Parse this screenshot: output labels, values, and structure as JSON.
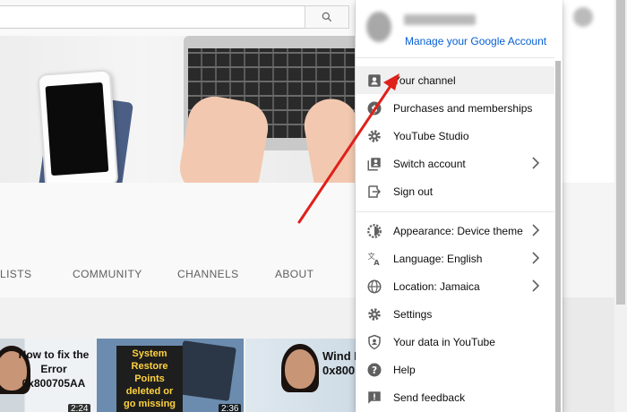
{
  "search": {
    "placeholder": ""
  },
  "icons": {
    "search": "search-icon"
  },
  "channel": {
    "tabs": [
      "LISTS",
      "COMMUNITY",
      "CHANNELS",
      "ABOUT"
    ]
  },
  "videos": [
    {
      "title": "How to fix the Error 0x800705AA",
      "duration": "2:24"
    },
    {
      "title": "System Restore Points deleted or go missing",
      "duration": "2:36"
    },
    {
      "title": "Wind Error 0x800",
      "duration": ""
    }
  ],
  "menu": {
    "manage_account": "Manage your Google Account",
    "group1": [
      {
        "label": "Your channel",
        "icon": "person-box-icon",
        "active": true
      },
      {
        "label": "Purchases and memberships",
        "icon": "dollar-icon"
      },
      {
        "label": "YouTube Studio",
        "icon": "gear-icon"
      },
      {
        "label": "Switch account",
        "icon": "switch-account-icon",
        "chevron": true
      },
      {
        "label": "Sign out",
        "icon": "sign-out-icon"
      }
    ],
    "group2": [
      {
        "label": "Appearance: Device theme",
        "icon": "appearance-icon",
        "chevron": true
      },
      {
        "label": "Language: English",
        "icon": "translate-icon",
        "chevron": true
      },
      {
        "label": "Location: Jamaica",
        "icon": "globe-icon",
        "chevron": true
      },
      {
        "label": "Settings",
        "icon": "gear-icon"
      },
      {
        "label": "Your data in YouTube",
        "icon": "shield-person-icon"
      },
      {
        "label": "Help",
        "icon": "help-icon"
      },
      {
        "label": "Send feedback",
        "icon": "feedback-icon"
      }
    ]
  },
  "colors": {
    "link": "#065fd4",
    "annotation": "#e0201a",
    "active_row": "#f0f0f0"
  }
}
